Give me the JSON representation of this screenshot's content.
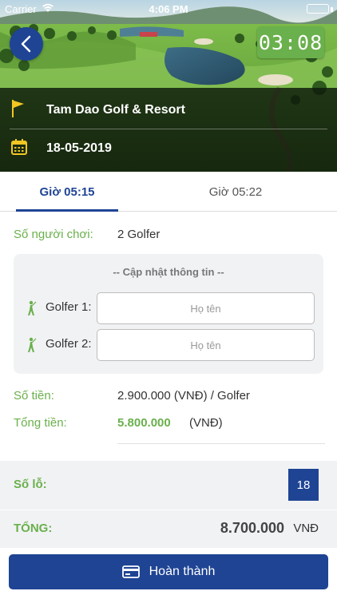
{
  "status_bar": {
    "carrier": "Carrier",
    "time": "4:06 PM"
  },
  "header": {
    "timer": "03:08",
    "course_name": "Tam Dao Golf & Resort",
    "date": "18-05-2019"
  },
  "tabs": [
    {
      "label": "Giờ 05:15",
      "active": true
    },
    {
      "label": "Giờ 05:22",
      "active": false
    }
  ],
  "booking": {
    "players_label": "Số người chơi:",
    "players_value": "2 Golfer",
    "update_title": "-- Cập nhật thông tin --",
    "golfers": [
      {
        "label": "Golfer 1:",
        "placeholder": "Họ tên"
      },
      {
        "label": "Golfer 2:",
        "placeholder": "Họ tên"
      }
    ],
    "fee_label": "Số tiền:",
    "fee_value": "2.900.000  (VNĐ) / Golfer",
    "total_label": "Tổng tiền:",
    "total_value": "5.800.000",
    "total_unit": "(VNĐ)"
  },
  "summary": {
    "holes_label": "Số lỗ:",
    "holes_value": "18",
    "grand_label": "TỔNG:",
    "grand_value": "8.700.000",
    "grand_unit": "VNĐ"
  },
  "footer": {
    "complete_label": "Hoàn thành"
  },
  "colors": {
    "primary_blue": "#1f4494",
    "accent_green": "#6ab04c",
    "panel_gray": "#f1f2f4"
  }
}
